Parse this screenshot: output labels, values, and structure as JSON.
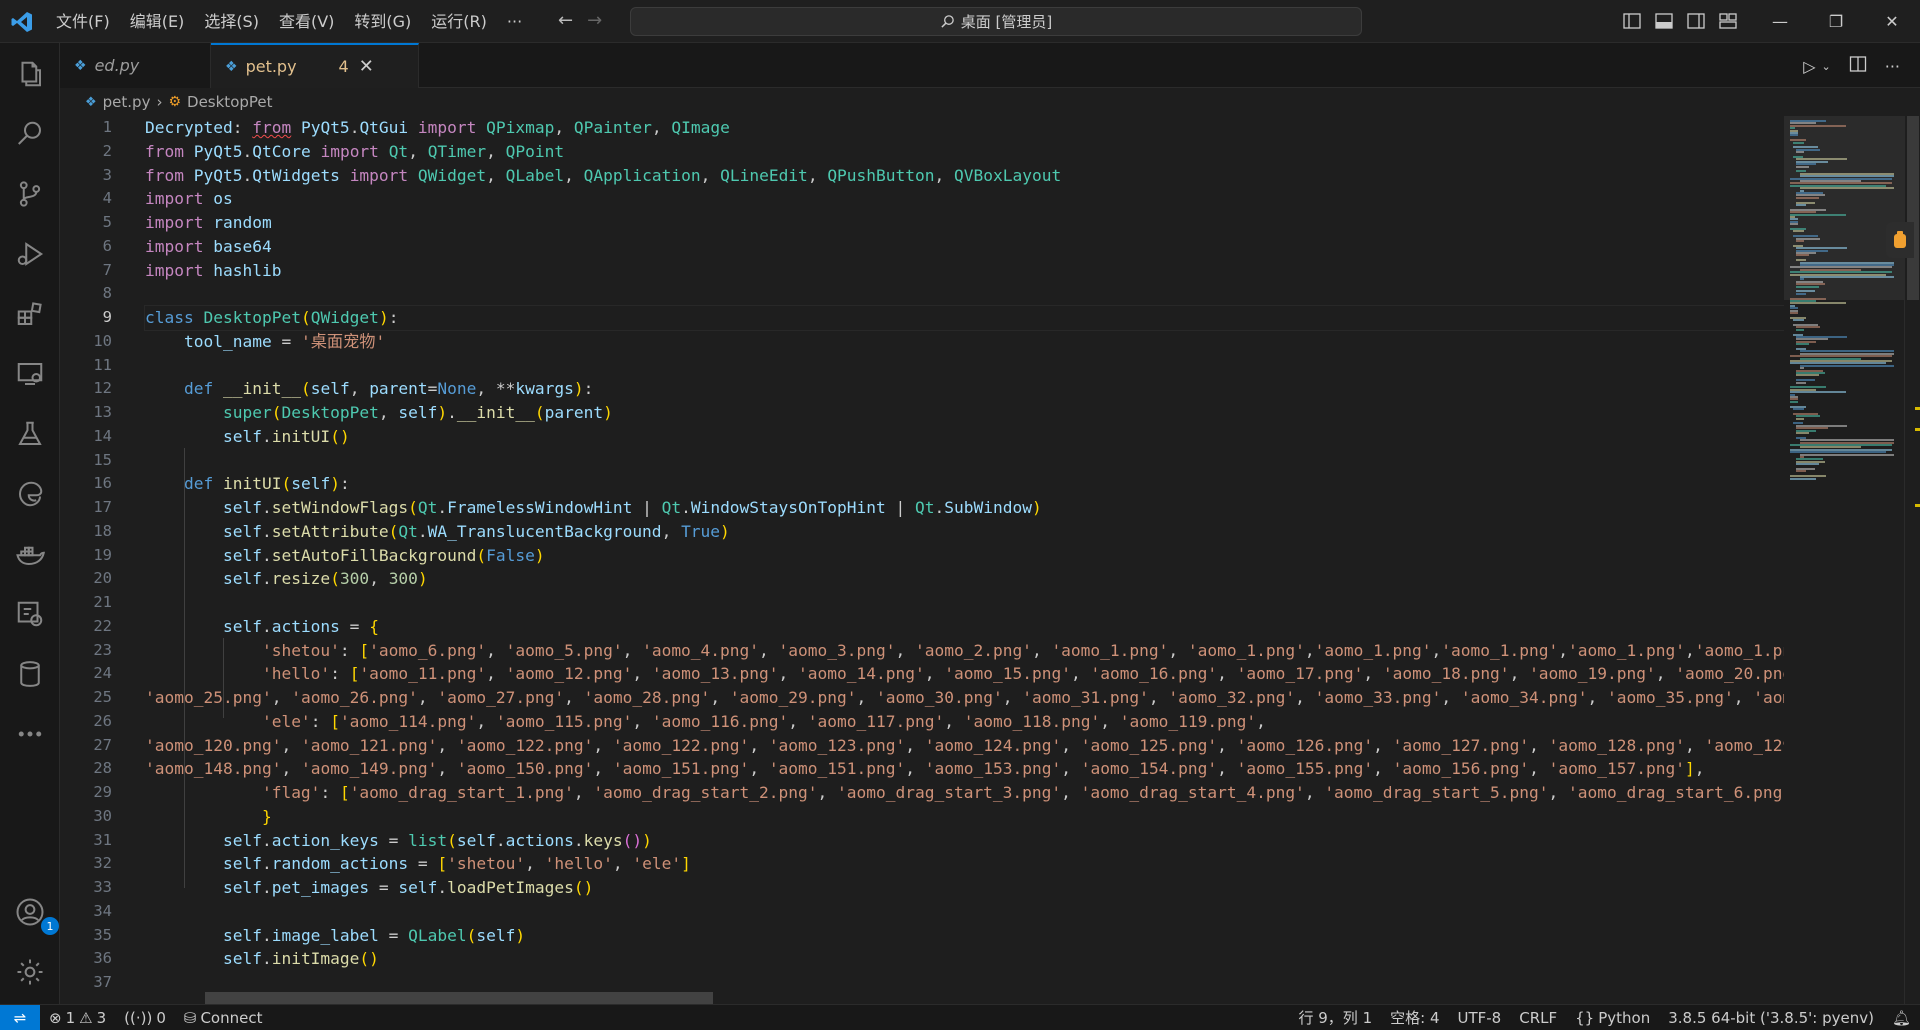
{
  "titlebar": {
    "menu": [
      "文件(F)",
      "编辑(E)",
      "选择(S)",
      "查看(V)",
      "转到(G)",
      "运行(R)",
      "···"
    ],
    "search_text": "桌面 [管理员]"
  },
  "tabs": [
    {
      "label": "ed.py",
      "active": false
    },
    {
      "label": "pet.py",
      "active": true,
      "problems": "4"
    }
  ],
  "breadcrumb": {
    "file": "pet.py",
    "symbol": "DesktopPet"
  },
  "editor": {
    "current_line": 9,
    "line_numbers": [
      "1",
      "2",
      "3",
      "4",
      "5",
      "6",
      "7",
      "8",
      "9",
      "10",
      "11",
      "12",
      "13",
      "14",
      "15",
      "16",
      "17",
      "18",
      "19",
      "20",
      "21",
      "22",
      "23",
      "24",
      "25",
      "26",
      "27",
      "28",
      "29",
      "30",
      "31",
      "32",
      "33",
      "34",
      "35",
      "36",
      "37"
    ],
    "lines": [
      "Decrypted: from PyQt5.QtGui import QPixmap, QPainter, QImage",
      "from PyQt5.QtCore import Qt, QTimer, QPoint",
      "from PyQt5.QtWidgets import QWidget, QLabel, QApplication, QLineEdit, QPushButton, QVBoxLayout",
      "import os",
      "import random",
      "import base64",
      "import hashlib",
      "",
      "class DesktopPet(QWidget):",
      "    tool_name = '桌面宠物'",
      "",
      "    def __init__(self, parent=None, **kwargs):",
      "        super(DesktopPet, self).__init__(parent)",
      "        self.initUI()",
      "",
      "    def initUI(self):",
      "        self.setWindowFlags(Qt.FramelessWindowHint | Qt.WindowStaysOnTopHint | Qt.SubWindow)",
      "        self.setAttribute(Qt.WA_TranslucentBackground, True)",
      "        self.setAutoFillBackground(False)",
      "        self.resize(300, 300)",
      "",
      "        self.actions = {",
      "            'shetou': ['aomo_6.png', 'aomo_5.png', 'aomo_4.png', 'aomo_3.png', 'aomo_2.png', 'aomo_1.png', 'aomo_1.png','aomo_1.png','aomo_1.png','aomo_1.png','aomo_1.png",
      "            'hello': ['aomo_11.png', 'aomo_12.png', 'aomo_13.png', 'aomo_14.png', 'aomo_15.png', 'aomo_16.png', 'aomo_17.png', 'aomo_18.png', 'aomo_19.png', 'aomo_20.png'",
      "'aomo_25.png', 'aomo_26.png', 'aomo_27.png', 'aomo_28.png', 'aomo_29.png', 'aomo_30.png', 'aomo_31.png', 'aomo_32.png', 'aomo_33.png', 'aomo_34.png', 'aomo_35.png', 'aomo",
      "            'ele': ['aomo_114.png', 'aomo_115.png', 'aomo_116.png', 'aomo_117.png', 'aomo_118.png', 'aomo_119.png',",
      "'aomo_120.png', 'aomo_121.png', 'aomo_122.png', 'aomo_122.png', 'aomo_123.png', 'aomo_124.png', 'aomo_125.png', 'aomo_126.png', 'aomo_127.png', 'aomo_128.png', 'aomo_129.",
      "'aomo_148.png', 'aomo_149.png', 'aomo_150.png', 'aomo_151.png', 'aomo_151.png', 'aomo_153.png', 'aomo_154.png', 'aomo_155.png', 'aomo_156.png', 'aomo_157.png'],",
      "            'flag': ['aomo_drag_start_1.png', 'aomo_drag_start_2.png', 'aomo_drag_start_3.png', 'aomo_drag_start_4.png', 'aomo_drag_start_5.png', 'aomo_drag_start_6.png',",
      "            }",
      "        self.action_keys = list(self.actions.keys())",
      "        self.random_actions = ['shetou', 'hello', 'ele']",
      "        self.pet_images = self.loadPetImages()",
      "",
      "        self.image_label = QLabel(self)",
      "        self.initImage()",
      ""
    ]
  },
  "statusbar": {
    "errors": "1",
    "warnings": "3",
    "ports": "0",
    "connect": "Connect",
    "position": "行 9，列 1",
    "spaces": "空格: 4",
    "encoding": "UTF-8",
    "eol": "CRLF",
    "language": "Python",
    "interpreter": "3.8.5 64-bit ('3.8.5': pyenv)"
  },
  "accounts_badge": "1",
  "colors": {
    "accent": "#0078d4",
    "keyword": "#569cd6",
    "control": "#c586c0",
    "class": "#4ec9b0",
    "function": "#dcdcaa",
    "string": "#ce9178",
    "variable": "#9cdcfe",
    "number": "#b5cea8",
    "modified_tab": "#e2c08d"
  }
}
